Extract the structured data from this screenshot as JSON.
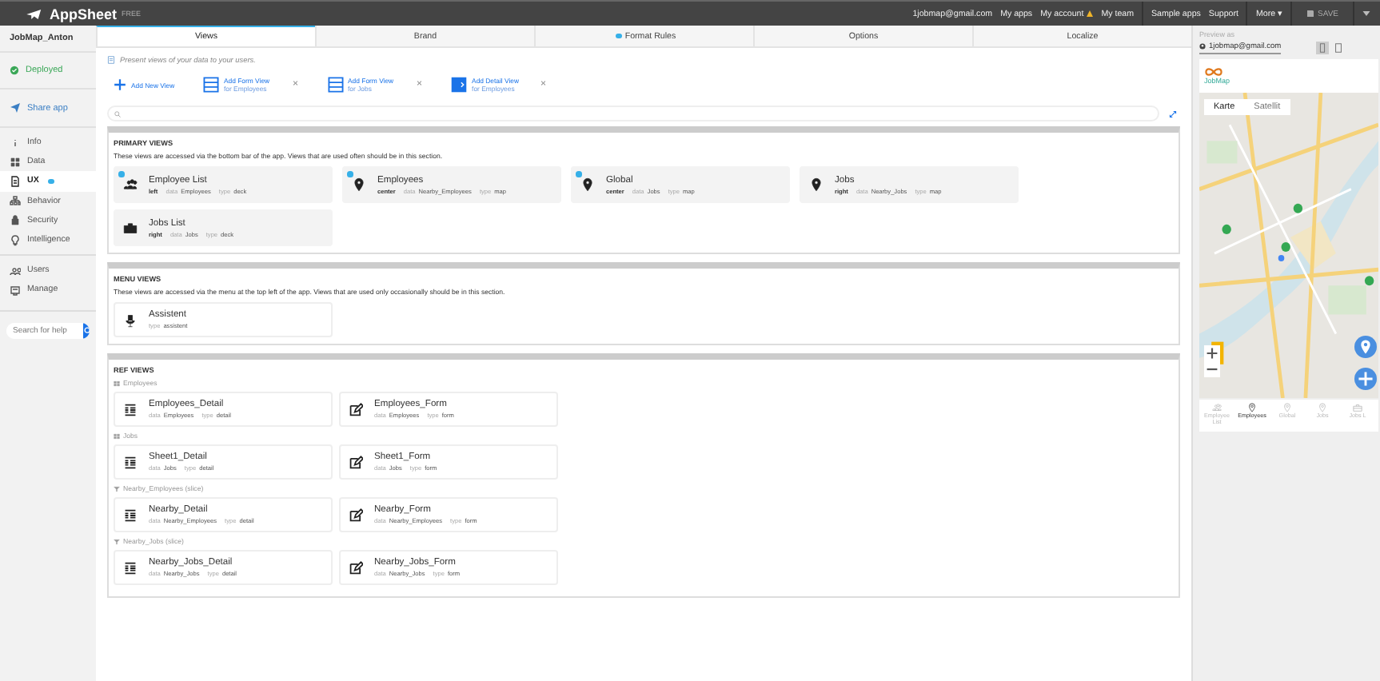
{
  "topbar": {
    "brand": "AppSheet",
    "plan": "FREE",
    "save": "SAVE",
    "links": [
      {
        "label": "1jobmap@gmail.com",
        "warning": false
      },
      {
        "label": "My apps",
        "warning": false
      },
      {
        "label": "My account",
        "warning": true
      },
      {
        "label": "My team",
        "warning": false
      },
      {
        "label": "Sample apps",
        "warning": false
      },
      {
        "label": "Support",
        "warning": false
      },
      {
        "label": "More ▾",
        "warning": false
      }
    ]
  },
  "sidebar": {
    "app_name": "JobMap_Anton",
    "status": "Deployed",
    "share": "Share app",
    "search": {
      "placeholder": "Search for help"
    },
    "items": [
      {
        "label": "Info",
        "kind": "info",
        "selected": false,
        "dot": false
      },
      {
        "label": "Data",
        "kind": "grid",
        "selected": false,
        "dot": false
      },
      {
        "label": "UX",
        "kind": "ux",
        "selected": true,
        "dot": true
      },
      {
        "label": "Behavior",
        "kind": "tree",
        "selected": false,
        "dot": false
      },
      {
        "label": "Security",
        "kind": "lock",
        "selected": false,
        "dot": false
      },
      {
        "label": "Intelligence",
        "kind": "bulb",
        "selected": false,
        "dot": false
      },
      {
        "label": "Users",
        "kind": "users",
        "selected": false,
        "dot": false
      },
      {
        "label": "Manage",
        "kind": "manage",
        "selected": false,
        "dot": false
      }
    ]
  },
  "tabs": [
    {
      "label": "Views",
      "selected": true,
      "dot": false
    },
    {
      "label": "Brand",
      "selected": false,
      "dot": false
    },
    {
      "label": "Format Rules",
      "selected": false,
      "dot": true
    },
    {
      "label": "Options",
      "selected": false,
      "dot": false
    },
    {
      "label": "Localize",
      "selected": false,
      "dot": false
    }
  ],
  "hint": "Present views of your data to your users.",
  "add_actions": [
    {
      "kind": "new",
      "title": "Add New View"
    },
    {
      "kind": "form",
      "title": "Add Form View",
      "subtitle": "for Employees",
      "close": "×"
    },
    {
      "kind": "form",
      "title": "Add Form View",
      "subtitle": "for Jobs",
      "close": "×"
    },
    {
      "kind": "detail",
      "title": "Add Detail View",
      "subtitle": "for Employees",
      "close": "×"
    }
  ],
  "sections": [
    {
      "title": "PRIMARY VIEWS",
      "description": "These views are accessed via the bottom bar of the app. Views that are used often should be in this section.",
      "groups": [
        {
          "views": [
            {
              "name": "Employee List",
              "kind": "people",
              "dot": true,
              "position": "left",
              "meta": [
                {
                  "label": "data",
                  "value": "Employees"
                },
                {
                  "label": "type",
                  "value": "deck"
                }
              ]
            },
            {
              "name": "Employees",
              "kind": "pin",
              "dot": true,
              "position": "center",
              "meta": [
                {
                  "label": "data",
                  "value": "Nearby_Employees"
                },
                {
                  "label": "type",
                  "value": "map"
                }
              ]
            },
            {
              "name": "Global",
              "kind": "pin",
              "dot": true,
              "position": "center",
              "meta": [
                {
                  "label": "data",
                  "value": "Jobs"
                },
                {
                  "label": "type",
                  "value": "map"
                }
              ]
            },
            {
              "name": "Jobs",
              "kind": "pin",
              "dot": false,
              "position": "right",
              "meta": [
                {
                  "label": "data",
                  "value": "Nearby_Jobs"
                },
                {
                  "label": "type",
                  "value": "map"
                }
              ]
            },
            {
              "name": "Jobs List",
              "kind": "briefcase",
              "dot": false,
              "position": "right",
              "meta": [
                {
                  "label": "data",
                  "value": "Jobs"
                },
                {
                  "label": "type",
                  "value": "deck"
                }
              ]
            }
          ]
        }
      ]
    },
    {
      "title": "MENU VIEWS",
      "description": "These views are accessed via the menu at the top left of the app. Views that are used only occasionally should be in this section.",
      "groups": [
        {
          "views": [
            {
              "name": "Assistent",
              "kind": "mic",
              "dot": false,
              "meta": [
                {
                  "label": "type",
                  "value": "assistent"
                }
              ]
            }
          ]
        }
      ]
    },
    {
      "title": "REF VIEWS",
      "groups": [
        {
          "label": "Employees",
          "kind": "table",
          "views": [
            {
              "name": "Employees_Detail",
              "kind": "detail",
              "dot": false,
              "meta": [
                {
                  "label": "data",
                  "value": "Employees"
                },
                {
                  "label": "type",
                  "value": "detail"
                }
              ]
            },
            {
              "name": "Employees_Form",
              "kind": "edit",
              "dot": false,
              "meta": [
                {
                  "label": "data",
                  "value": "Employees"
                },
                {
                  "label": "type",
                  "value": "form"
                }
              ]
            }
          ]
        },
        {
          "label": "Jobs",
          "kind": "table",
          "views": [
            {
              "name": "Sheet1_Detail",
              "kind": "detail",
              "dot": false,
              "meta": [
                {
                  "label": "data",
                  "value": "Jobs"
                },
                {
                  "label": "type",
                  "value": "detail"
                }
              ]
            },
            {
              "name": "Sheet1_Form",
              "kind": "edit",
              "dot": false,
              "meta": [
                {
                  "label": "data",
                  "value": "Jobs"
                },
                {
                  "label": "type",
                  "value": "form"
                }
              ]
            }
          ]
        },
        {
          "label": "Nearby_Employees (slice)",
          "kind": "filter",
          "views": [
            {
              "name": "Nearby_Detail",
              "kind": "detail",
              "dot": false,
              "meta": [
                {
                  "label": "data",
                  "value": "Nearby_Employees"
                },
                {
                  "label": "type",
                  "value": "detail"
                }
              ]
            },
            {
              "name": "Nearby_Form",
              "kind": "edit",
              "dot": false,
              "meta": [
                {
                  "label": "data",
                  "value": "Nearby_Employees"
                },
                {
                  "label": "type",
                  "value": "form"
                }
              ]
            }
          ]
        },
        {
          "label": "Nearby_Jobs (slice)",
          "kind": "filter",
          "views": [
            {
              "name": "Nearby_Jobs_Detail",
              "kind": "detail",
              "dot": false,
              "meta": [
                {
                  "label": "data",
                  "value": "Nearby_Jobs"
                },
                {
                  "label": "type",
                  "value": "detail"
                }
              ]
            },
            {
              "name": "Nearby_Jobs_Form",
              "kind": "edit",
              "dot": false,
              "meta": [
                {
                  "label": "data",
                  "value": "Nearby_Jobs"
                },
                {
                  "label": "type",
                  "value": "form"
                }
              ]
            }
          ]
        }
      ]
    }
  ],
  "preview": {
    "label": "Preview as",
    "user": "1jobmap@gmail.com",
    "devices": [
      {
        "kind": "phone",
        "selected": true
      },
      {
        "kind": "tablet",
        "selected": false
      }
    ],
    "app_logo_text": "JobMap",
    "map_types": [
      {
        "label": "Karte",
        "selected": true
      },
      {
        "label": "Satellit",
        "selected": false
      }
    ],
    "nav": [
      {
        "label": "Employee List",
        "kind": "people",
        "selected": false
      },
      {
        "label": "Employees",
        "kind": "pin",
        "selected": true
      },
      {
        "label": "Global",
        "kind": "pin",
        "selected": false
      },
      {
        "label": "Jobs",
        "kind": "pin",
        "selected": false
      },
      {
        "label": "Jobs L",
        "kind": "briefcase",
        "selected": false
      }
    ]
  }
}
